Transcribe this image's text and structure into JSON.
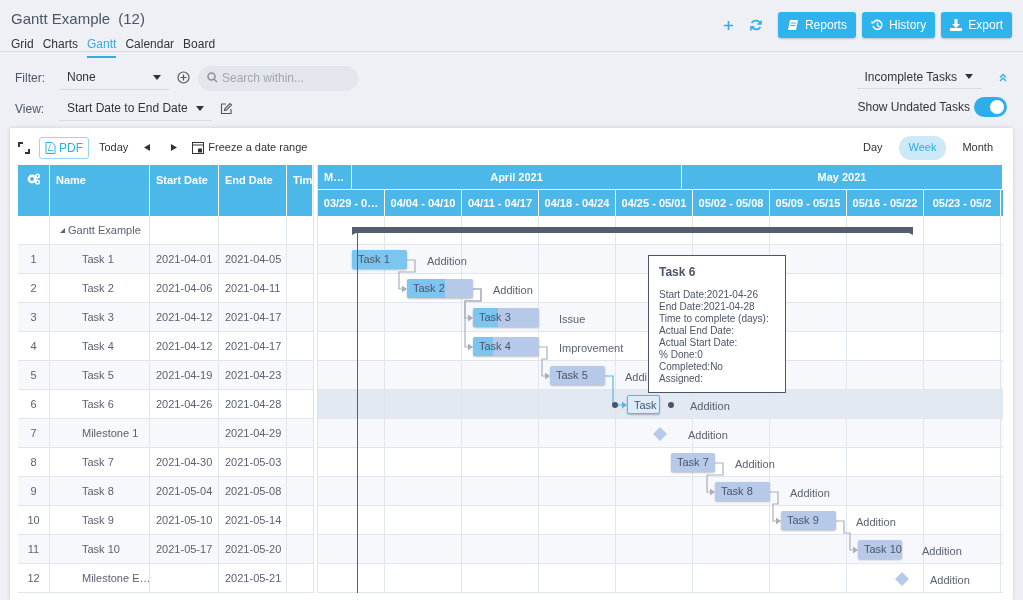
{
  "title": "Gantt Example",
  "count": "(12)",
  "tabs": [
    {
      "label": "Grid",
      "selected": false
    },
    {
      "label": "Charts",
      "selected": false
    },
    {
      "label": "Gantt",
      "selected": true
    },
    {
      "label": "Calendar",
      "selected": false
    },
    {
      "label": "Board",
      "selected": false
    }
  ],
  "actions": [
    {
      "kind": "reports",
      "label": "Reports"
    },
    {
      "kind": "history",
      "label": "History"
    },
    {
      "kind": "export",
      "label": "Export"
    }
  ],
  "filter": {
    "label": "Filter:",
    "value": "None"
  },
  "search": {
    "placeholder": "Search within..."
  },
  "view": {
    "label": "View:",
    "value": "Start Date to End Date"
  },
  "task_filter": "Incomplete Tasks",
  "undated": {
    "label": "Show Undated Tasks",
    "on": true
  },
  "toolbar": {
    "pdf": "PDF",
    "today": "Today",
    "freeze": "Freeze a date range"
  },
  "scales": [
    {
      "label": "Day",
      "selected": false
    },
    {
      "label": "Week",
      "selected": true
    },
    {
      "label": "Month",
      "selected": false
    }
  ],
  "grid_columns": [
    "Name",
    "Start Date",
    "End Date",
    "Tim"
  ],
  "months": [
    "M…",
    "April 2021",
    "May 2021"
  ],
  "weeks": [
    "03/29 - 0…",
    "04/04 - 04/10",
    "04/11 - 04/17",
    "04/18 - 04/24",
    "04/25 - 05/01",
    "05/02 - 05/08",
    "05/09 - 05/15",
    "05/16 - 05/22",
    "05/23 - 05/2"
  ],
  "summary": {
    "name": "Gantt Example",
    "expanded": true
  },
  "rows": [
    {
      "number": "1",
      "name": "Task 1",
      "start": "2021-04-01",
      "end": "2021-04-05",
      "kind": "task",
      "bar_label": "Task 1",
      "type": "Addition",
      "level": 1,
      "selected": false
    },
    {
      "number": "2",
      "name": "Task 2",
      "start": "2021-04-06",
      "end": "2021-04-11",
      "kind": "task",
      "bar_label": "Task 2",
      "type": "Addition",
      "level": 0.58,
      "selected": false,
      "linked_to_previous": true
    },
    {
      "number": "3",
      "name": "Task 3",
      "start": "2021-04-12",
      "end": "2021-04-17",
      "kind": "task",
      "bar_label": "Task 3",
      "type": "Issue",
      "level": 0.38,
      "selected": false,
      "linked_to_previous": true
    },
    {
      "number": "4",
      "name": "Task 4",
      "start": "2021-04-12",
      "end": "2021-04-17",
      "kind": "task",
      "bar_label": "Task 4",
      "type": "Improvement",
      "level": 0.3,
      "selected": false,
      "linked_to_second_previous": true
    },
    {
      "number": "5",
      "name": "Task 5",
      "start": "2021-04-19",
      "end": "2021-04-23",
      "kind": "task",
      "bar_label": "Task 5",
      "type": "Addi",
      "selected": false,
      "linked_to_previous": true
    },
    {
      "number": "6",
      "name": "Task 6",
      "start": "2021-04-26",
      "end": "2021-04-28",
      "kind": "task",
      "bar_label": "Task",
      "type": "Addition",
      "selected": true,
      "linked_to_previous": true
    },
    {
      "number": "7",
      "name": "Milestone 1",
      "end": "2021-04-29",
      "kind": "milestone",
      "type": "Addition",
      "selected": false
    },
    {
      "number": "8",
      "name": "Task 7",
      "start": "2021-04-30",
      "end": "2021-05-03",
      "kind": "task",
      "bar_label": "Task 7",
      "type": "Addition",
      "selected": false
    },
    {
      "number": "9",
      "name": "Task 8",
      "start": "2021-05-04",
      "end": "2021-05-08",
      "kind": "task",
      "bar_label": "Task 8",
      "type": "Addition",
      "selected": false,
      "linked_to_previous": true
    },
    {
      "number": "10",
      "name": "Task 9",
      "start": "2021-05-10",
      "end": "2021-05-14",
      "kind": "task",
      "bar_label": "Task 9",
      "type": "Addition",
      "selected": false,
      "linked_to_previous": true
    },
    {
      "number": "11",
      "name": "Task 10",
      "start": "2021-05-17",
      "end": "2021-05-20",
      "kind": "task",
      "bar_label": "Task 10",
      "type": "Addition",
      "selected": false,
      "linked_to_previous": true
    },
    {
      "number": "12",
      "name": "Milestone E…",
      "end": "2021-05-21",
      "kind": "milestone",
      "type": "Addition",
      "selected": false
    }
  ],
  "tooltip": {
    "title": "Task 6",
    "lines": [
      "Start Date:2021-04-26",
      "End Date:2021-04-28",
      "Time to complete (days):",
      "Actual End Date:",
      "Actual Start Date:",
      "% Done:0",
      "Completed:No",
      "Assigned:"
    ]
  }
}
